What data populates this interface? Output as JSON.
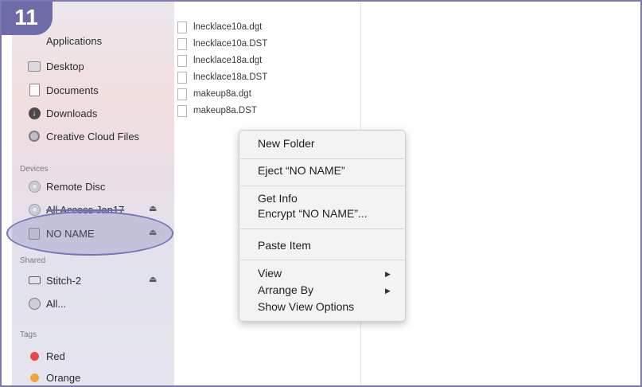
{
  "step_number": "11",
  "sidebar": {
    "favorites": [
      {
        "label": "Applications",
        "icon": "applications-icon"
      },
      {
        "label": "Desktop",
        "icon": "desktop-icon"
      },
      {
        "label": "Documents",
        "icon": "documents-icon"
      },
      {
        "label": "Downloads",
        "icon": "downloads-icon"
      },
      {
        "label": "Creative Cloud Files",
        "icon": "creative-cloud-icon"
      }
    ],
    "devices_header": "Devices",
    "devices": [
      {
        "label": "Remote Disc",
        "icon": "disc-icon"
      },
      {
        "label": "All Access Jan17",
        "icon": "disc-icon",
        "eject": "⏏"
      },
      {
        "label": "NO NAME",
        "icon": "drive-icon",
        "eject": "⏏",
        "selected": true
      }
    ],
    "shared_header": "Shared",
    "shared": [
      {
        "label": "Stitch-2",
        "icon": "computer-icon",
        "eject": "⏏"
      },
      {
        "label": "All...",
        "icon": "network-icon"
      }
    ],
    "tags_header": "Tags",
    "tags": [
      {
        "label": "Red",
        "color": "#e8474b"
      },
      {
        "label": "Orange",
        "color": "#f2a336"
      }
    ]
  },
  "files": [
    "lnecklace10a.dgt",
    "lnecklace10a.DST",
    "lnecklace18a.dgt",
    "lnecklace18a.DST",
    "makeup8a.dgt",
    "makeup8a.DST"
  ],
  "context_menu": {
    "new_folder": "New Folder",
    "eject": "Eject “NO NAME”",
    "get_info": "Get Info",
    "encrypt": "Encrypt “NO NAME”...",
    "paste_item": "Paste Item",
    "view": "View",
    "arrange_by": "Arrange By",
    "show_view_options": "Show View Options",
    "submenu_arrow": "▶"
  },
  "colors": {
    "badge": "#6d6ba8",
    "highlight": "#7176b8"
  }
}
